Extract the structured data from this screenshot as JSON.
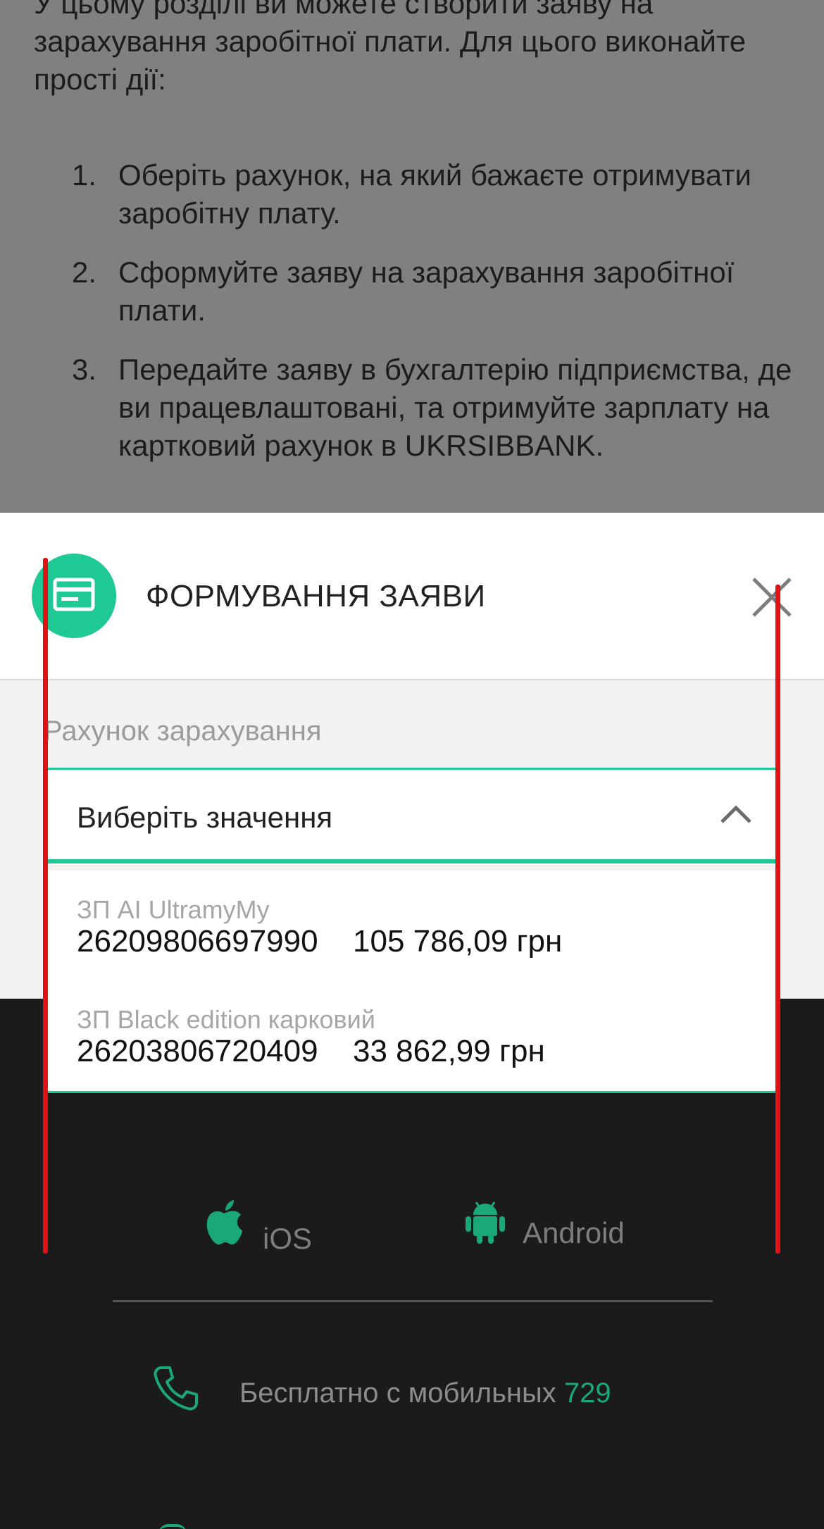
{
  "background": {
    "intro": "У цьому розділі ви можете створити заяву на зарахування заробітної плати. Для цього виконайте прості дії:",
    "steps": [
      {
        "num": "1.",
        "text": "Оберіть рахунок, на який бажаєте отримувати заробітну плату."
      },
      {
        "num": "2.",
        "text": "Сформуйте заяву на зарахування заробітної плати."
      },
      {
        "num": "3.",
        "text": "Передайте заяву в бухгалтерію підприємства, де ви працевлаштовані, та отримуйте зарплату на картковий рахунок в UKRSIBBANK."
      }
    ]
  },
  "modal": {
    "title": "ФОРМУВАННЯ ЗАЯВИ",
    "icon": "card-icon",
    "close_icon": "close-icon",
    "field_label": "Рахунок зарахування",
    "select_placeholder": "Виберіть значення"
  },
  "dropdown": {
    "options": [
      {
        "name": "ЗП AI UltramyMy",
        "account": "26209806697990",
        "balance": "105 786,09 грн"
      },
      {
        "name": "ЗП Black edition карковий",
        "account": "26203806720409",
        "balance": "33 862,99 грн"
      }
    ]
  },
  "footer": {
    "ios_label": "iOS",
    "android_label": "Android",
    "phone_text": "Бесплатно с мобильных",
    "phone_number": "729"
  },
  "colors": {
    "accent": "#1ec995",
    "annotation": "#e21212",
    "footer_bg": "#1b1b1b"
  }
}
